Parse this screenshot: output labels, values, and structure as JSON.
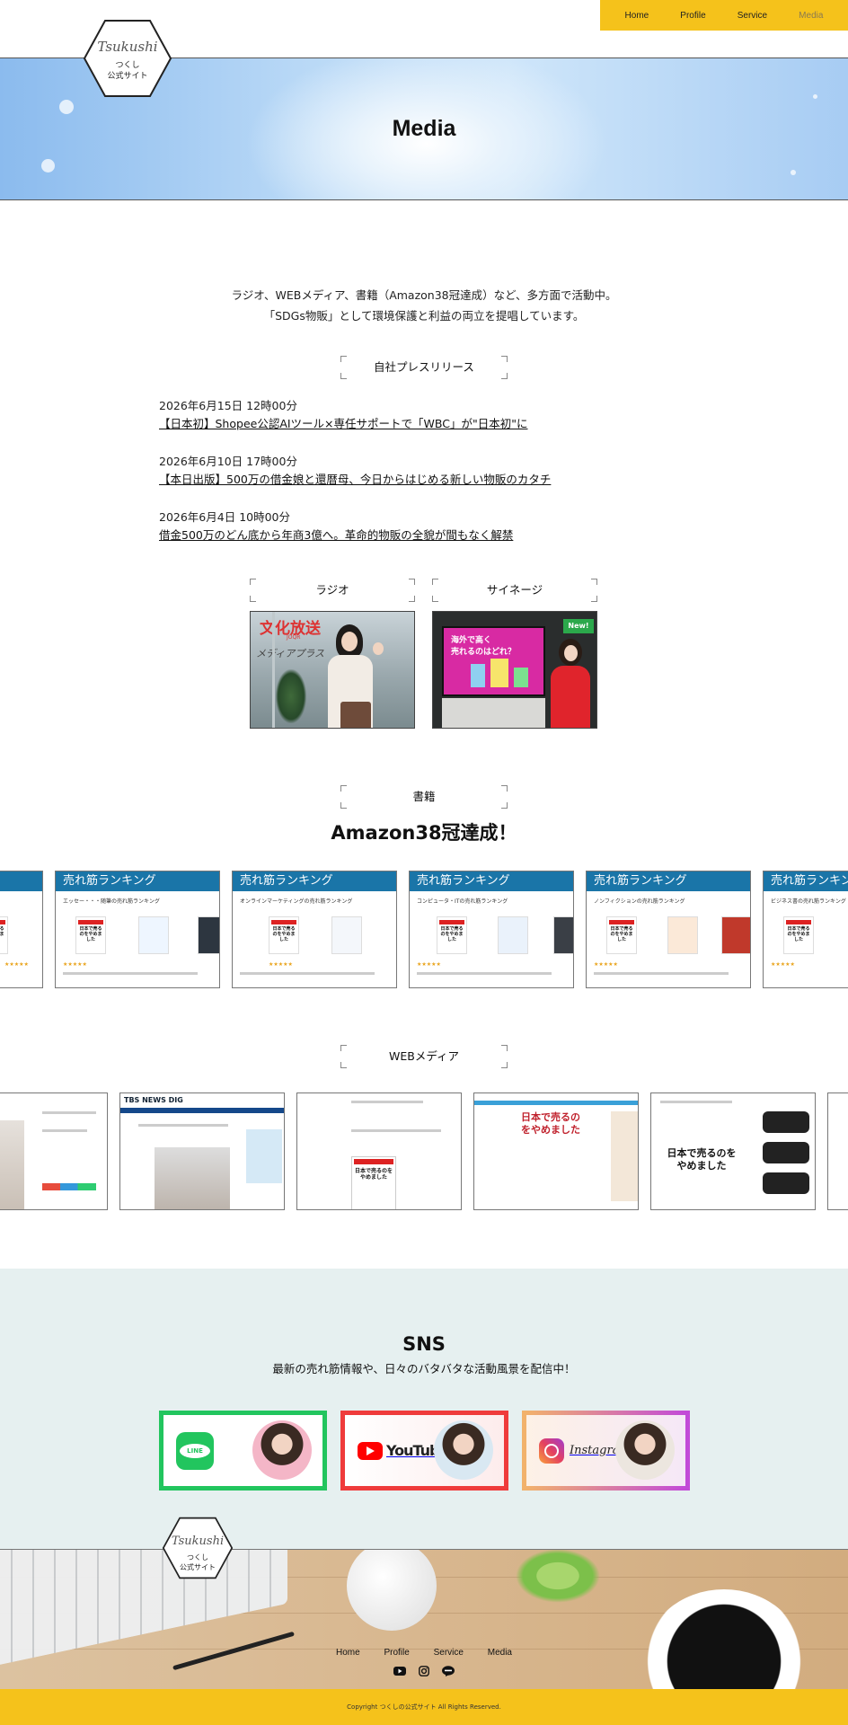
{
  "logo": {
    "script": "Tsukushi",
    "line1": "つくし",
    "line2": "公式サイト"
  },
  "nav": {
    "items": [
      "Home",
      "Profile",
      "Service",
      "Media"
    ],
    "current": "Media"
  },
  "hero": {
    "title": "Media"
  },
  "intro": {
    "line1": "ラジオ、WEBメディア、書籍（Amazon38冠達成）など、多方面で活動中。",
    "line2": "「SDGs物販」として環境保護と利益の両立を提唱しています。"
  },
  "press": {
    "heading": "自社プレスリリース",
    "items": [
      {
        "date": "2026年6月15日 12時00分",
        "title": "【日本初】Shopee公認AIツール×専任サポートで「WBC」が\"日本初\"に"
      },
      {
        "date": "2026年6月10日 17時00分",
        "title": "【本日出版】500万の借金娘と還暦母、今日からはじめる新しい物販のカタチ"
      },
      {
        "date": "2026年6月4日 10時00分",
        "title": "借金500万のどん底から年商3億へ。革命的物販の全貌が間もなく解禁"
      }
    ]
  },
  "radio": {
    "heading": "ラジオ",
    "photo_text": {
      "logo": "文化放送",
      "sub": "JOQR",
      "wall": "メディアプラス"
    }
  },
  "signage": {
    "heading": "サイネージ",
    "screen_lines": [
      "海外で高く",
      "売れるのはどれ？"
    ],
    "sign": "New!"
  },
  "books": {
    "heading": "書籍",
    "title": "Amazon38冠達成！",
    "ranking_band": "売れ筋ランキング",
    "cards": [
      {
        "category": ""
      },
      {
        "category": "エッセー・・・随筆の売れ筋ランキング"
      },
      {
        "category": "オンラインマーケティングの売れ筋ランキング"
      },
      {
        "category": "コンピュータ・ITの売れ筋ランキング"
      },
      {
        "category": "ノンフィクションの売れ筋ランキング"
      },
      {
        "category": "ビジネス書の売れ筋ランキング"
      }
    ],
    "book_cover": "日本で売るのをやめました"
  },
  "web_media": {
    "heading": "WEBメディア",
    "cards": [
      {
        "label": ""
      },
      {
        "label": "TBS NEWS DIG"
      },
      {
        "label": "日本で売るのをやめました"
      },
      {
        "label": "日本で売るのをやめました"
      },
      {
        "label": "日本で売るのをやめました"
      },
      {
        "label": ""
      }
    ]
  },
  "sns": {
    "title": "SNS",
    "subtitle": "最新の売れ筋情報や、日々のバタバタな活動風景を配信中！",
    "cards": [
      {
        "name": "LINE",
        "border": "#22c55e"
      },
      {
        "name": "YouTube",
        "border": "#ef3b3b"
      },
      {
        "name": "Instagram",
        "border": "#c24ad8"
      }
    ]
  },
  "footer": {
    "nav": [
      "Home",
      "Profile",
      "Service",
      "Media"
    ],
    "icons": [
      "youtube-icon",
      "instagram-icon",
      "line-icon"
    ],
    "copyright": "Copyright つくしの公式サイト All Rights Reserved."
  },
  "colors": {
    "accent": "#f5c21b",
    "hero": "#a7ccf3",
    "sns_bg": "#e6f0f0",
    "ranking_band": "#1a75a8"
  }
}
